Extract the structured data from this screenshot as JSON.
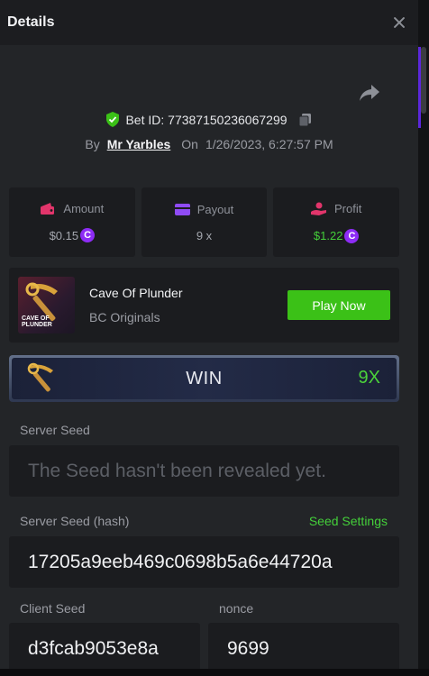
{
  "header": {
    "title": "Details"
  },
  "bet": {
    "id_label": "Bet ID: 77387150236067299",
    "by_label": "By",
    "user": "Mr Yarbles",
    "on_label": "On",
    "timestamp": "1/26/2023, 6:27:57 PM"
  },
  "stats": {
    "amount": {
      "label": "Amount",
      "value": "$0.15"
    },
    "payout": {
      "label": "Payout",
      "value": "9 x"
    },
    "profit": {
      "label": "Profit",
      "value": "$1.22"
    },
    "coin_symbol": "C",
    "colors": {
      "amount_icon": "#e2356b",
      "payout_icon": "#8f4bf5",
      "profit_icon": "#e2356b",
      "profit_value": "#44cf3a",
      "coin": "#8d2cf5"
    }
  },
  "game": {
    "thumb_text": "CAVE OF PLUNDER",
    "name": "Cave Of Plunder",
    "provider": "BC Originals",
    "play_label": "Play Now"
  },
  "result": {
    "label": "WIN",
    "multiplier": "9X"
  },
  "seeds": {
    "server_seed_label": "Server Seed",
    "server_seed_value": "The Seed hasn't been revealed yet.",
    "server_seed_hash_label": "Server Seed (hash)",
    "seed_settings_label": "Seed Settings",
    "server_seed_hash_value": "17205a9eeb469c0698b5a6e44720a",
    "client_seed_label": "Client Seed",
    "client_seed_value": "d3fcab9053e8a",
    "nonce_label": "nonce",
    "nonce_value": "9699"
  },
  "icons": {
    "close": "close-icon",
    "share": "share-icon",
    "shield": "shield-check-icon",
    "copy": "copy-icon",
    "amount": "wallet-icon",
    "payout": "card-icon",
    "profit": "hand-coin-icon",
    "result": "pickaxe-icon"
  }
}
